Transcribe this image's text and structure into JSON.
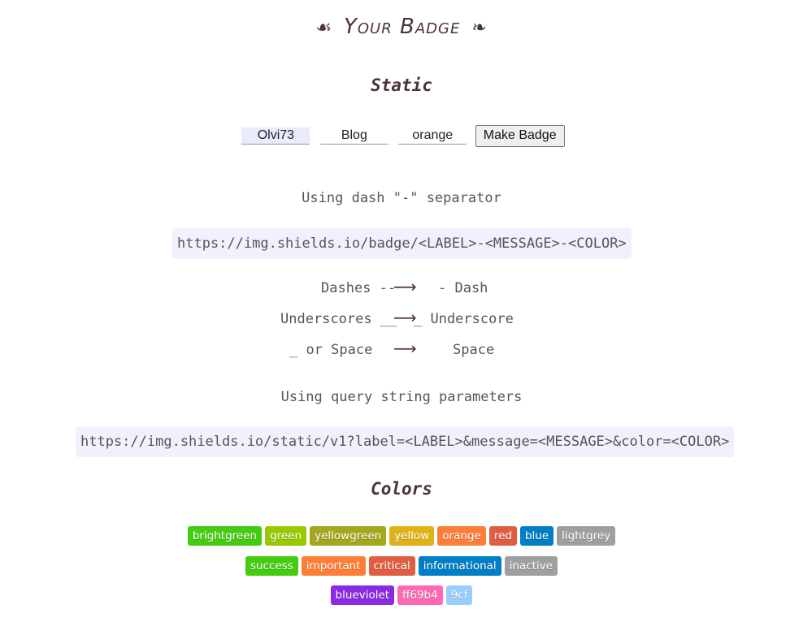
{
  "header": {
    "title": "Your Badge",
    "left_ornament": "☙",
    "right_ornament": "❧"
  },
  "static_section": {
    "title": "Static",
    "form": {
      "label_value": "Olvi73",
      "message_value": "Blog",
      "color_value": "orange",
      "button_label": "Make Badge"
    },
    "dash_separator_text": "Using dash \"-\" separator",
    "dash_url": "https://img.shields.io/badge/<LABEL>-<MESSAGE>-<COLOR>",
    "rules": [
      {
        "from": "Dashes --",
        "to": "- Dash"
      },
      {
        "from": "Underscores __",
        "to": "_ Underscore"
      },
      {
        "from": "_ or Space",
        "to": "Space"
      }
    ],
    "arrow": "⟶",
    "query_text": "Using query string parameters",
    "query_url": "https://img.shields.io/static/v1?label=<LABEL>&message=<MESSAGE>&color=<COLOR>"
  },
  "colors_section": {
    "title": "Colors",
    "rows": [
      [
        {
          "label": "brightgreen",
          "color": "#44cc11"
        },
        {
          "label": "green",
          "color": "#97ca00"
        },
        {
          "label": "yellowgreen",
          "color": "#a4a61d"
        },
        {
          "label": "yellow",
          "color": "#dfb317"
        },
        {
          "label": "orange",
          "color": "#fe7d37"
        },
        {
          "label": "red",
          "color": "#e05d44"
        },
        {
          "label": "blue",
          "color": "#007ec6"
        },
        {
          "label": "lightgrey",
          "color": "#9f9f9f"
        }
      ],
      [
        {
          "label": "success",
          "color": "#44cc11"
        },
        {
          "label": "important",
          "color": "#fe7d37"
        },
        {
          "label": "critical",
          "color": "#e05d44"
        },
        {
          "label": "informational",
          "color": "#007ec6"
        },
        {
          "label": "inactive",
          "color": "#9f9f9f"
        }
      ],
      [
        {
          "label": "blueviolet",
          "color": "#8a2be2"
        },
        {
          "label": "ff69b4",
          "color": "#ff69b4"
        },
        {
          "label": "9cf",
          "color": "#99ccff"
        }
      ]
    ]
  }
}
